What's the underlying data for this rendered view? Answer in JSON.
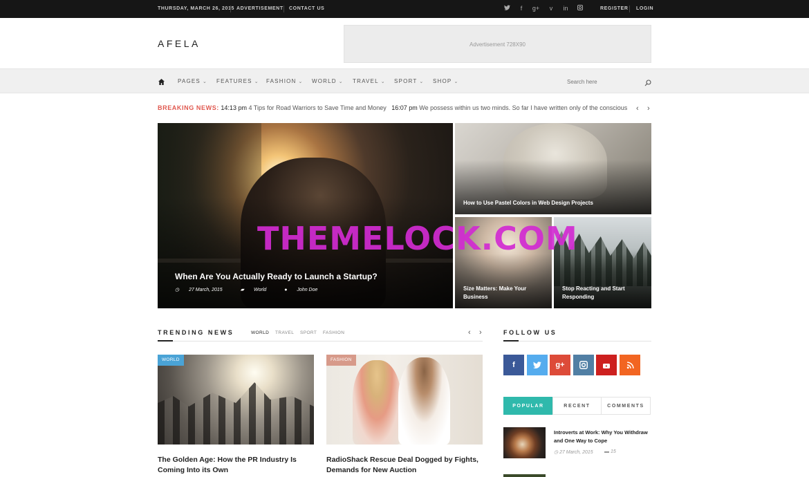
{
  "topbar": {
    "date": "THURSDAY, MARCH 26, 2015",
    "links": [
      "ADVERTISEMENT",
      "CONTACT US"
    ],
    "auth": [
      "REGISTER",
      "LOGIN"
    ],
    "social_icons": [
      "twitter-icon",
      "facebook-icon",
      "google-plus-icon",
      "vimeo-icon",
      "linkedin-icon",
      "instagram-icon"
    ]
  },
  "header": {
    "logo": "AFELA",
    "ad_text": "Advertisement 728X90"
  },
  "nav": {
    "items": [
      "PAGES",
      "FEATURES",
      "FASHION",
      "WORLD",
      "TRAVEL",
      "SPORT",
      "SHOP"
    ],
    "caret": "⌄",
    "search_placeholder": "Search here"
  },
  "breaking": {
    "label": "BREAKING NEWS:",
    "items": [
      {
        "time": "14:13 pm",
        "text": "4 Tips for Road Warriors to Save Time and Money"
      },
      {
        "time": "16:07 pm",
        "text": "We possess within us two minds. So far I have written only of the conscious"
      }
    ]
  },
  "hero": {
    "main": {
      "title": "When Are You Actually Ready to Launch a Startup?",
      "date": "27 March, 2015",
      "category": "World",
      "author": "John Doe"
    },
    "top_right": {
      "title": "How to Use Pastel Colors in Web Design Projects"
    },
    "bottom_left": {
      "title": "Size Matters: Make Your Business"
    },
    "bottom_right": {
      "title": "Stop Reacting and Start Responding"
    }
  },
  "watermark": "THEMELOCK.COM",
  "trending": {
    "title": "TRENDING NEWS",
    "tabs": [
      "WORLD",
      "TRAVEL",
      "SPORT",
      "FASHION"
    ],
    "cards": [
      {
        "badge": "WORLD",
        "badge_color": "#4aa3d6",
        "title": "The Golden Age: How the PR Industry Is Coming Into its Own"
      },
      {
        "badge": "FASHION",
        "badge_color": "#d79a8a",
        "title": "RadioShack Rescue Deal Dogged by Fights, Demands for New Auction"
      }
    ]
  },
  "follow": {
    "title": "FOLLOW US",
    "buttons": [
      {
        "icon": "facebook-icon",
        "glyph": "f",
        "color": "#3b5998"
      },
      {
        "icon": "twitter-icon",
        "glyph": "t",
        "color": "#55acee"
      },
      {
        "icon": "google-plus-icon",
        "glyph": "g+",
        "color": "#dd4b39"
      },
      {
        "icon": "instagram-icon",
        "glyph": "◘",
        "color": "#517fa4"
      },
      {
        "icon": "youtube-icon",
        "glyph": "▶",
        "color": "#cd201f"
      },
      {
        "icon": "rss-icon",
        "glyph": "◔",
        "color": "#f26522"
      }
    ]
  },
  "widget": {
    "tabs": [
      "POPULAR",
      "RECENT",
      "COMMENTS"
    ],
    "accent": "#2fb9ac",
    "popular": [
      {
        "title": "Introverts at Work: Why You Withdraw and One Way to Cope",
        "date": "27 March, 2015",
        "comments": "15"
      }
    ]
  }
}
